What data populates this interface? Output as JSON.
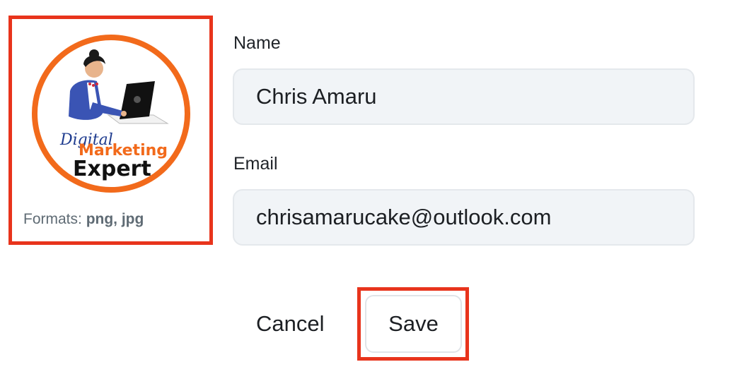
{
  "avatar": {
    "logo_text": {
      "line1": "Digital",
      "line2": "Marketing",
      "line3": "Expert"
    },
    "formats_label": "Formats:",
    "formats_value": "png, jpg"
  },
  "form": {
    "name_label": "Name",
    "name_value": "Chris Amaru",
    "email_label": "Email",
    "email_value": "chrisamarucake@outlook.com"
  },
  "actions": {
    "cancel_label": "Cancel",
    "save_label": "Save"
  },
  "colors": {
    "highlight": "#e8341c",
    "logo_ring": "#f26a1b",
    "input_bg": "#f1f4f7"
  },
  "icons": {
    "avatar": "digital-marketing-expert-logo"
  }
}
